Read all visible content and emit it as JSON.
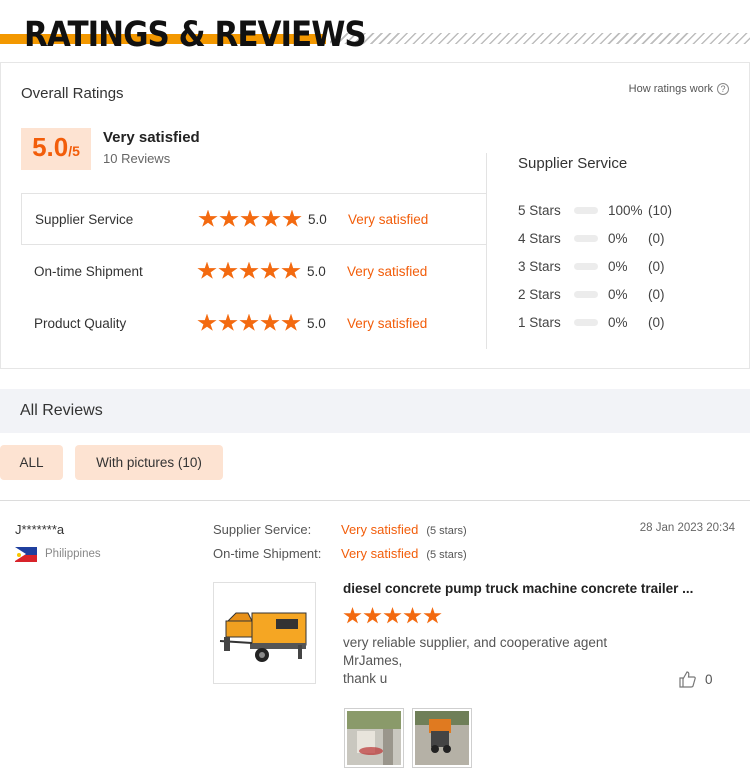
{
  "header": {
    "title": "RATINGS & REVIEWS"
  },
  "overall": {
    "title": "Overall Ratings",
    "how_link": "How ratings work",
    "how_icon": "question-circle-icon",
    "score": "5.0",
    "score_max": "/5",
    "satisfaction": "Very satisfied",
    "reviews_count": "10 Reviews",
    "categories": [
      {
        "label": "Supplier Service",
        "stars": 5,
        "score": "5.0",
        "satisfaction": "Very satisfied"
      },
      {
        "label": "On-time Shipment",
        "stars": 5,
        "score": "5.0",
        "satisfaction": "Very satisfied"
      },
      {
        "label": "Product Quality",
        "stars": 5,
        "score": "5.0",
        "satisfaction": "Very satisfied"
      }
    ],
    "distribution": {
      "title": "Supplier Service",
      "rows": [
        {
          "label": "5 Stars",
          "fraction": 1.0,
          "pct": "100%",
          "count": "(10)"
        },
        {
          "label": "4 Stars",
          "fraction": 0,
          "pct": "0%",
          "count": "(0)"
        },
        {
          "label": "3 Stars",
          "fraction": 0,
          "pct": "0%",
          "count": "(0)"
        },
        {
          "label": "2 Stars",
          "fraction": 0,
          "pct": "0%",
          "count": "(0)"
        },
        {
          "label": "1 Stars",
          "fraction": 0,
          "pct": "0%",
          "count": "(0)"
        }
      ]
    }
  },
  "reviews": {
    "title": "All Reviews",
    "filters": {
      "all": "ALL",
      "pictures": "With pictures (10)"
    },
    "items": [
      {
        "reviewer": "J*******a",
        "country": "Philippines",
        "date": "28 Jan 2023 20:34",
        "meta": [
          {
            "label": "Supplier Service:",
            "value": "Very satisfied",
            "stars": "(5 stars)"
          },
          {
            "label": "On-time Shipment:",
            "value": "Very satisfied",
            "stars": "(5 stars)"
          }
        ],
        "product_title": "diesel concrete pump truck machine concrete trailer ...",
        "rating": 5,
        "text_lines": [
          "very reliable supplier, and cooperative agent",
          "MrJames,",
          "thank u"
        ],
        "likes": "0"
      }
    ]
  },
  "colors": {
    "accent": "#f25d0a",
    "banner": "#f39800",
    "badge_bg": "#fde3d2"
  }
}
